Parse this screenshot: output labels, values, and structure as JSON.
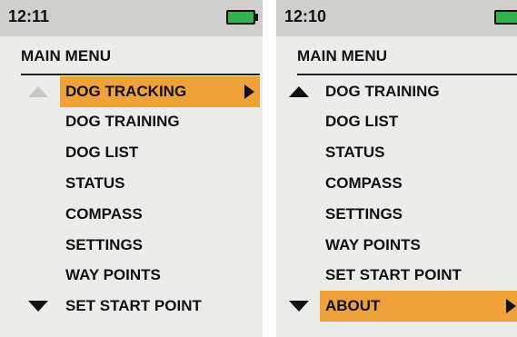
{
  "screens": [
    {
      "clock": "12:11",
      "title": "MAIN MENU",
      "items": [
        "DOG TRACKING",
        "DOG TRAINING",
        "DOG LIST",
        "STATUS",
        "COMPASS",
        "SETTINGS",
        "WAY POINTS",
        "SET START POINT"
      ],
      "selected": "DOG TRACKING",
      "scroll_up_enabled": false,
      "scroll_down_enabled": true,
      "battery_level": 1.0
    },
    {
      "clock": "12:10",
      "title": "MAIN MENU",
      "items": [
        "DOG TRAINING",
        "DOG LIST",
        "STATUS",
        "COMPASS",
        "SETTINGS",
        "WAY POINTS",
        "SET START POINT",
        "ABOUT"
      ],
      "selected": "ABOUT",
      "scroll_up_enabled": true,
      "scroll_down_enabled": true,
      "battery_level": 1.0
    }
  ],
  "colors": {
    "highlight": "#f0a23a",
    "battery": "#2fb34a",
    "status_bar": "#cfcfcd",
    "screen_bg": "#ececea"
  },
  "icons": {
    "scroll_up": "triangle-up-icon",
    "scroll_down": "triangle-down-icon",
    "submenu": "triangle-right-icon",
    "battery": "battery-icon"
  }
}
